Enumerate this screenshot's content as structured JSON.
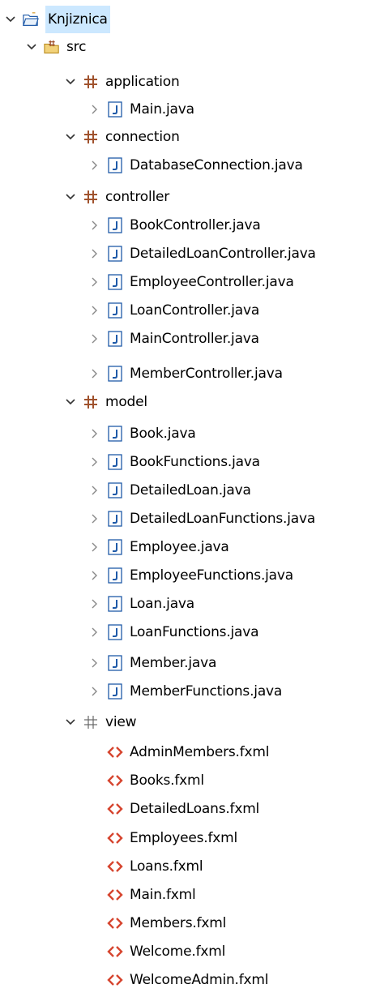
{
  "tree": {
    "project": "Knjiznica",
    "src": "src",
    "packages": [
      {
        "name": "application",
        "files": [
          "Main.java"
        ]
      },
      {
        "name": "connection",
        "files": [
          "DatabaseConnection.java"
        ]
      },
      {
        "name": "controller",
        "files": [
          "BookController.java",
          "DetailedLoanController.java",
          "EmployeeController.java",
          "LoanController.java",
          "MainController.java",
          "MemberController.java"
        ]
      },
      {
        "name": "model",
        "files": [
          "Book.java",
          "BookFunctions.java",
          "DetailedLoan.java",
          "DetailedLoanFunctions.java",
          "Employee.java",
          "EmployeeFunctions.java",
          "Loan.java",
          "LoanFunctions.java",
          "Member.java",
          "MemberFunctions.java"
        ]
      },
      {
        "name": "view",
        "files": [
          "AdminMembers.fxml",
          "Books.fxml",
          "DetailedLoans.fxml",
          "Employees.fxml",
          "Loans.fxml",
          "Main.fxml",
          "Members.fxml",
          "Welcome.fxml",
          "WelcomeAdmin.fxml"
        ]
      }
    ]
  },
  "colors": {
    "selection": "#cce8ff",
    "package_icon": "#a0522d",
    "java_icon": "#1f5aa8",
    "fxml_icon": "#d6452f"
  }
}
